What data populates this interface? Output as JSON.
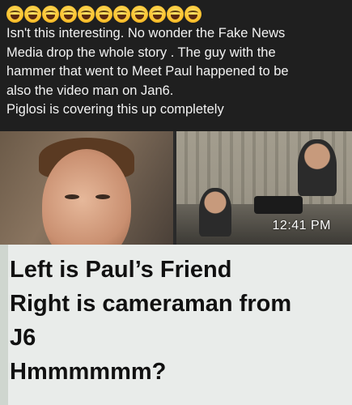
{
  "post": {
    "emoji_count": 11,
    "lines": [
      "Isn't this interesting. No wonder the Fake News",
      "Media drop the whole story . The guy with the",
      "hammer that went to Meet Paul  happened to be",
      "also the video man on Jan6.",
      "Piglosi is covering this up completely"
    ]
  },
  "image": {
    "timestamp": "12:41 PM",
    "caption_lines": [
      "Left is Paul’s Friend",
      "Right is cameraman from",
      "J6",
      "Hmmmmmm?"
    ]
  },
  "colors": {
    "background": "#1f1f1f",
    "text": "#f2f2f2",
    "caption_bg": "#e9ecea"
  }
}
